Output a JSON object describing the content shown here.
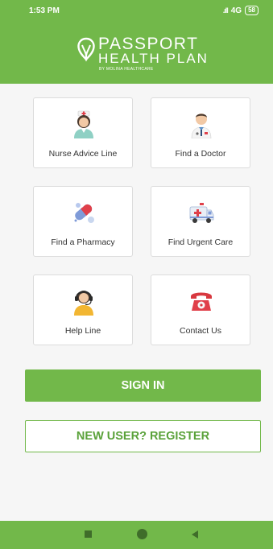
{
  "status_bar": {
    "time": "1:53 PM",
    "network": "4G",
    "battery": "58"
  },
  "logo": {
    "line1": "PASSPORT",
    "line2": "HEALTH PLAN",
    "line3": "BY MOLINA HEALTHCARE"
  },
  "tiles": [
    {
      "label": "Nurse Advice Line",
      "icon": "nurse-icon"
    },
    {
      "label": "Find a Doctor",
      "icon": "doctor-icon"
    },
    {
      "label": "Find a Pharmacy",
      "icon": "pills-icon"
    },
    {
      "label": "Find Urgent Care",
      "icon": "ambulance-icon"
    },
    {
      "label": "Help Line",
      "icon": "headset-agent-icon"
    },
    {
      "label": "Contact Us",
      "icon": "telephone-icon"
    }
  ],
  "buttons": {
    "sign_in": "SIGN IN",
    "register": "NEW USER? REGISTER"
  },
  "colors": {
    "brand_green": "#72b84a",
    "nav_icon": "#3f6d2a"
  }
}
